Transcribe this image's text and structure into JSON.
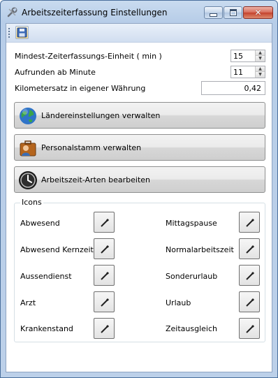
{
  "window": {
    "title": "Arbeitszeiterfassung Einstellungen",
    "icon": "wrench-tools-icon",
    "controls": {
      "minimize": "minimize-icon",
      "maximize": "maximize-icon",
      "close": "✕"
    }
  },
  "toolbar": {
    "save_icon": "floppy-disk-icon"
  },
  "settings": {
    "min_unit_label": "Mindest-Zeiterfassungs-Einheit ( min )",
    "min_unit_value": "15",
    "round_label": "Aufrunden ab Minute",
    "round_value": "11",
    "km_label": "Kilometersatz in eigener Währung",
    "km_value": "0,42"
  },
  "buttons": {
    "countries": "Ländereinstellungen verwalten",
    "staff": "Personalstamm verwalten",
    "worktime_types": "Arbeitszeit-Arten bearbeiten"
  },
  "icons_group": {
    "title": "Icons",
    "left": [
      "Abwesend",
      "Abwesend Kernzeit",
      "Aussendienst",
      "Arzt",
      "Krankenstand"
    ],
    "right": [
      "Mittagspause",
      "Normalarbeitszeit",
      "Sonderurlaub",
      "Urlaub",
      "Zeitausgleich"
    ]
  },
  "colors": {
    "accent": "#4a6f9c",
    "button_face": "#e6e6e6"
  }
}
